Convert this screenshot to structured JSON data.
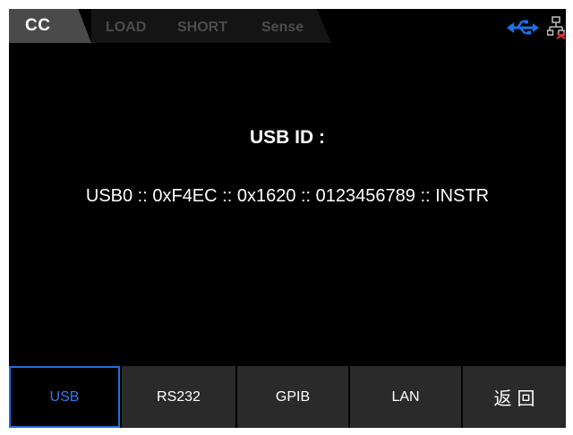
{
  "status_bar": {
    "mode": "CC",
    "indicators": [
      "LOAD",
      "SHORT",
      "Sense"
    ],
    "usb_icon": "usb-icon",
    "network_icon": "network-disconnected-icon",
    "usb_icon_color": "#1a73e8",
    "network_alert_color": "#e03030"
  },
  "main": {
    "title": "USB ID :",
    "value": "USB0 :: 0xF4EC :: 0x1620 :: 0123456789 :: INSTR"
  },
  "softkeys": [
    {
      "label": "USB",
      "active": true
    },
    {
      "label": "RS232",
      "active": false
    },
    {
      "label": "GPIB",
      "active": false
    },
    {
      "label": "LAN",
      "active": false
    },
    {
      "label": "返回",
      "active": false
    }
  ],
  "colors": {
    "active_softkey": "#2f7cf2",
    "softkey_bg": "#2a2a2a",
    "screen_bg": "#000000"
  }
}
